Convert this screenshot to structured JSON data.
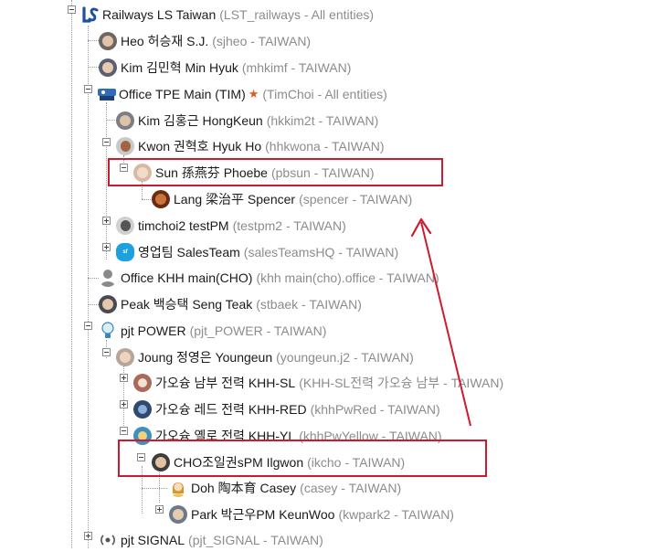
{
  "tree": {
    "root": {
      "name": "Railways LS Taiwan",
      "sub": "(LST_railways - All entities)",
      "icon": "ls-logo-icon"
    },
    "nodes": [
      {
        "name": "Heo 허승재 S.J.",
        "sub": "(sjheo - TAIWAN)",
        "icon": "user-photo-icon"
      },
      {
        "name": "Kim 김민혁 Min Hyuk",
        "sub": "(mhkimf - TAIWAN)",
        "icon": "user-photo-icon"
      },
      {
        "name": "Office TPE Main (TIM)",
        "sub": "(TimChoi - All entities)",
        "icon": "office-logo-icon",
        "star": "★"
      },
      {
        "name": "Kim 김홍근 HongKeun",
        "sub": "(hkkim2t - TAIWAN)",
        "icon": "user-photo-icon"
      },
      {
        "name": "Kwon 권혁호 Hyuk Ho",
        "sub": "(hhkwona - TAIWAN)",
        "icon": "user-photo-icon"
      },
      {
        "name": "Sun 孫燕芬 Phoebe",
        "sub": "(pbsun - TAIWAN)",
        "icon": "user-photo-icon"
      },
      {
        "name": "Lang 梁治平 Spencer",
        "sub": "(spencer - TAIWAN)",
        "icon": "user-photo-icon"
      },
      {
        "name": "timchoi2 testPM",
        "sub": "(testpm2 - TAIWAN)",
        "icon": "user-photo-icon"
      },
      {
        "name": "영업팀 SalesTeam",
        "sub": "(salesTeamsHQ - TAIWAN)",
        "icon": "salesforce-cloud-icon"
      },
      {
        "name": "Office KHH main(CHO)",
        "sub": "(khh main(cho).office - TAIWAN)",
        "icon": "default-user-icon"
      },
      {
        "name": "Peak 백승택 Seng Teak",
        "sub": "(stbaek - TAIWAN)",
        "icon": "user-photo-icon"
      },
      {
        "name": "pjt POWER",
        "sub": "(pjt_POWER - TAIWAN)",
        "icon": "lightbulb-icon"
      },
      {
        "name": "Joung 정영은 Youngeun",
        "sub": "(youngeun.j2 - TAIWAN)",
        "icon": "user-photo-icon"
      },
      {
        "name": "가오슝 남부 전력 KHH-SL",
        "sub": "(KHH-SL전력 가오슝 남부 - TAIWAN)",
        "icon": "team-icon"
      },
      {
        "name": "가오슝 레드 전력 KHH-RED",
        "sub": "(khhPwRed - TAIWAN)",
        "icon": "team-icon"
      },
      {
        "name": "가오슝 옐로 전력 KHH-YL",
        "sub": "(khhPwYellow - TAIWAN)",
        "icon": "team-icon"
      },
      {
        "name": "CHO조일권sPM Ilgwon",
        "sub": "(ikcho - TAIWAN)",
        "icon": "user-photo-icon"
      },
      {
        "name": "Doh 陶本育 Casey",
        "sub": "(casey - TAIWAN)",
        "icon": "user-avatar-icon"
      },
      {
        "name": "Park 박근우PM KeunWoo",
        "sub": "(kwpark2 - TAIWAN)",
        "icon": "user-photo-icon"
      },
      {
        "name": "pjt SIGNAL",
        "sub": "(pjt_SIGNAL - TAIWAN)",
        "icon": "signal-icon"
      }
    ]
  },
  "colors": {
    "highlight": "#cc1b2e",
    "arrow": "#cc1b2e",
    "label": "#1a1a1a",
    "sublabel": "#8c8c8c",
    "star": "#e25a2b"
  }
}
